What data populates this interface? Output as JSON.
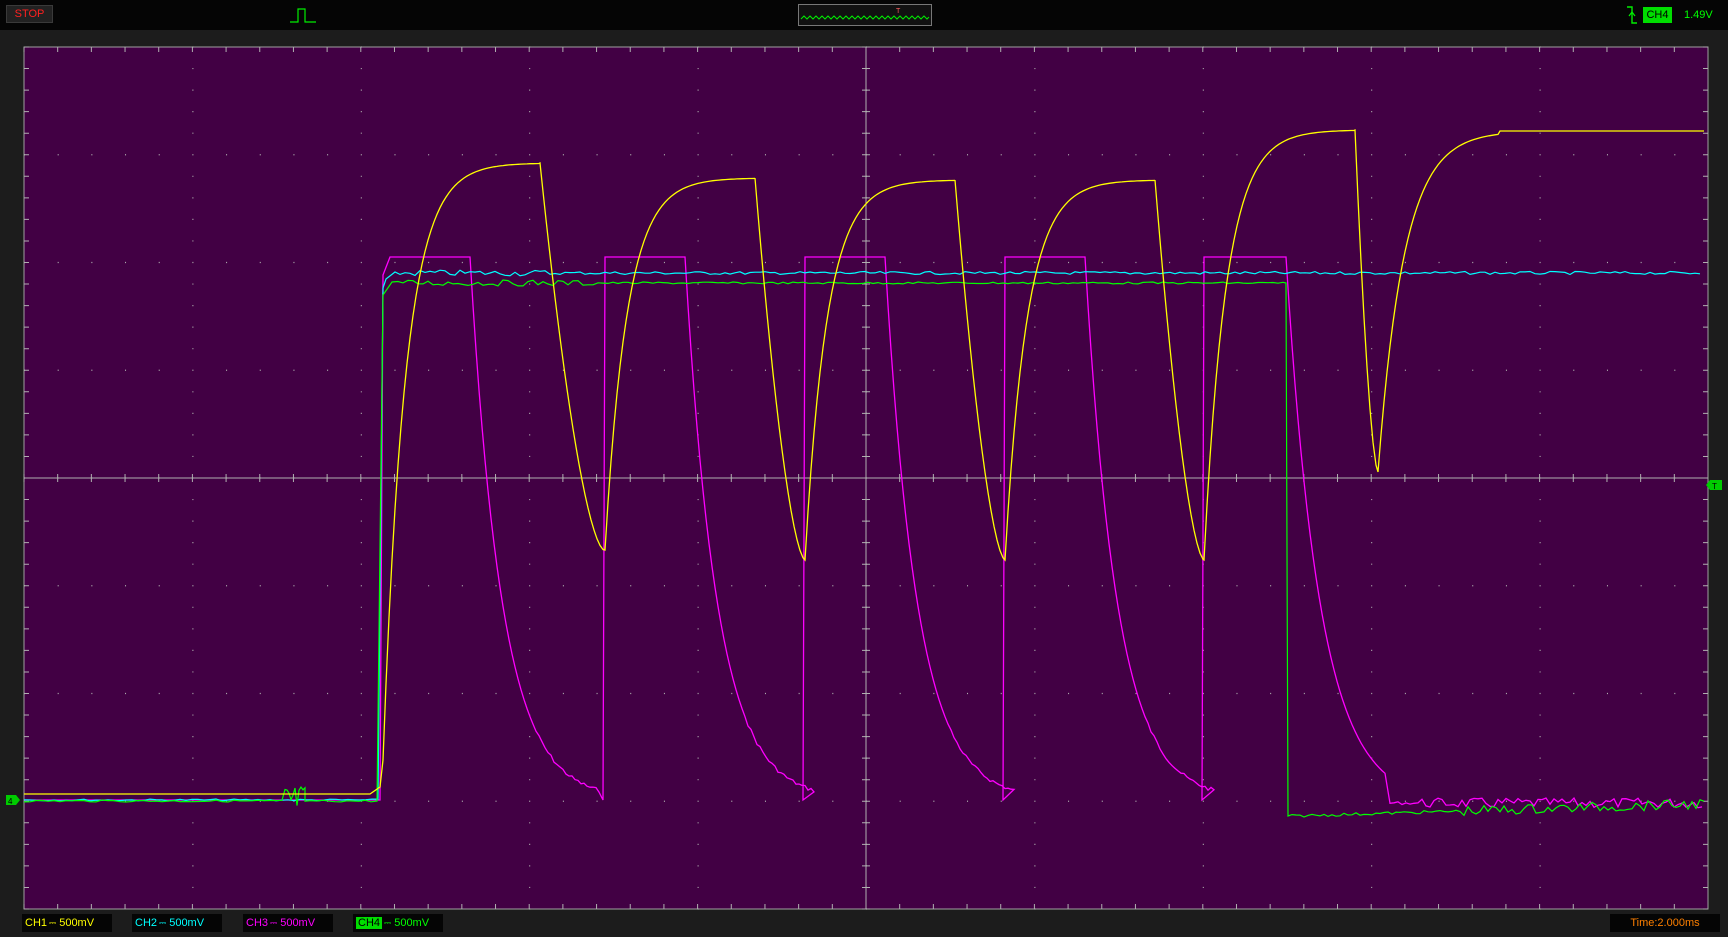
{
  "status": {
    "run_state": "STOP"
  },
  "trigger": {
    "source": "CH4",
    "level": "1.49V",
    "marker": "T"
  },
  "channels": [
    {
      "name": "CH1",
      "coupling": "DC",
      "scale": "500mV",
      "color": "#ffff00"
    },
    {
      "name": "CH2",
      "coupling": "DC",
      "scale": "500mV",
      "color": "#00ffff"
    },
    {
      "name": "CH3",
      "coupling": "DC",
      "scale": "500mV",
      "color": "#ff00ff"
    },
    {
      "name": "CH4",
      "coupling": "DC",
      "scale": "500mV",
      "color": "#00ff00"
    }
  ],
  "timebase": {
    "label": "Time:2.000ms"
  },
  "colors": {
    "screen_bg": "#420044",
    "grid": "#b0b0b0",
    "frame": "#1c1c1c",
    "ch1": "#ffff00",
    "ch2": "#00ffff",
    "ch3": "#ff00ff",
    "ch4": "#00ff00",
    "stop": "#ff2020",
    "time": "#ff8000"
  },
  "icons": [
    "trigger-pulse-icon",
    "rising-edge-icon",
    "ground-marker-icon",
    "trigger-level-marker-icon"
  ]
}
